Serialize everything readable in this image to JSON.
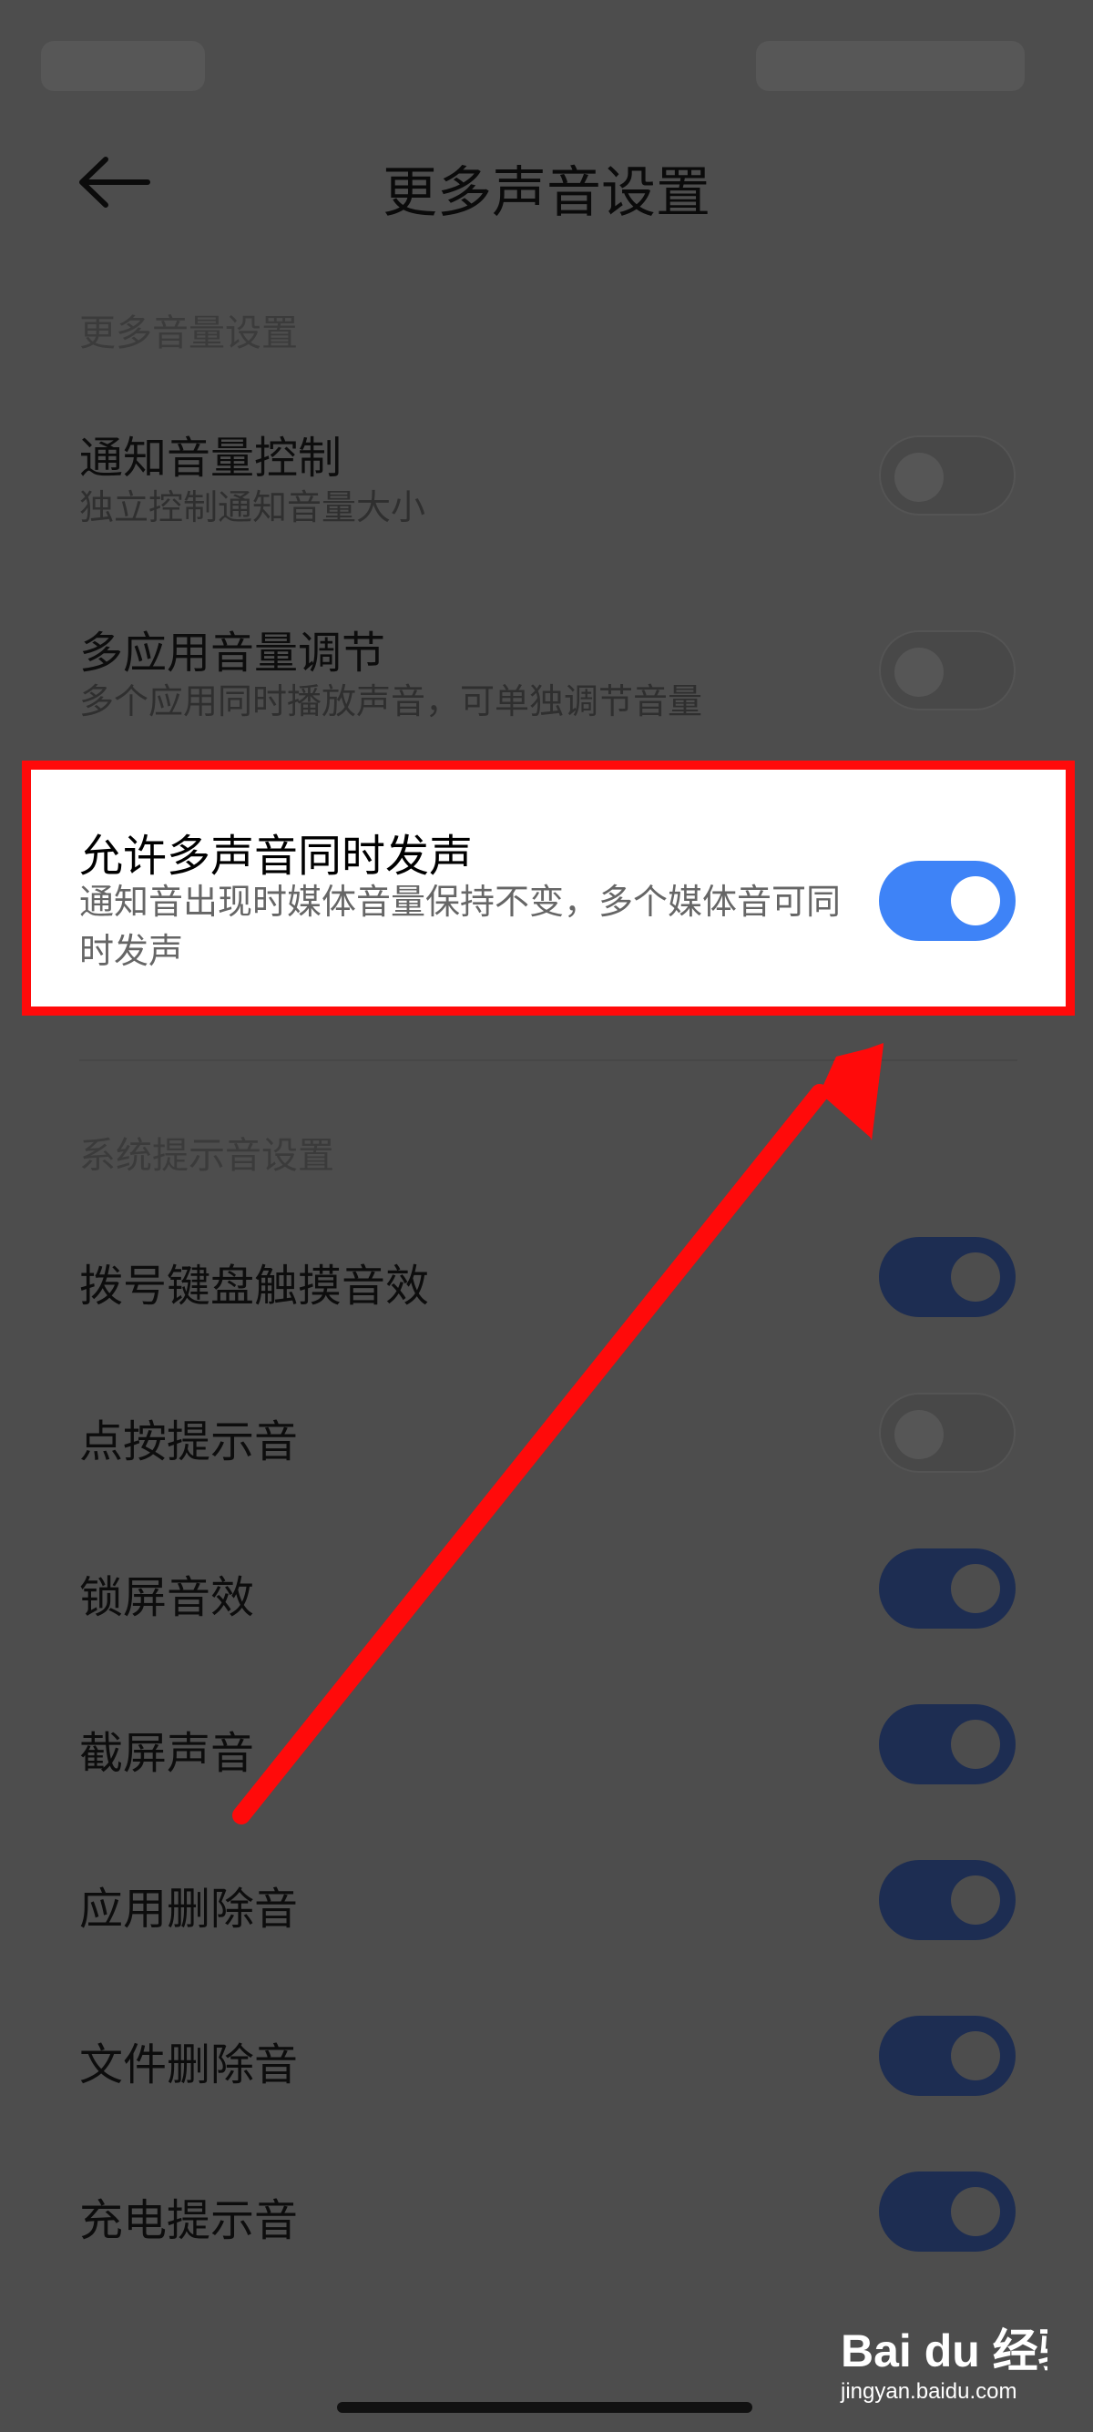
{
  "header": {
    "title": "更多声音设置"
  },
  "sections": [
    {
      "header": "更多音量设置",
      "items": [
        {
          "title": "通知音量控制",
          "subtitle": "独立控制通知音量大小",
          "enabled": false
        },
        {
          "title": "多应用音量调节",
          "subtitle": "多个应用同时播放声音，可单独调节音量",
          "enabled": false
        },
        {
          "title": "允许多声音同时发声",
          "subtitle": "通知音出现时媒体音量保持不变，多个媒体音可同时发声",
          "enabled": true
        }
      ]
    },
    {
      "header": "系统提示音设置",
      "items": [
        {
          "title": "拨号键盘触摸音效",
          "enabled": true
        },
        {
          "title": "点按提示音",
          "enabled": false
        },
        {
          "title": "锁屏音效",
          "enabled": true
        },
        {
          "title": "截屏声音",
          "enabled": true
        },
        {
          "title": "应用删除音",
          "enabled": true
        },
        {
          "title": "文件删除音",
          "enabled": true
        },
        {
          "title": "充电提示音",
          "enabled": true
        }
      ]
    }
  ],
  "watermark": {
    "brand": "Bai du 经验",
    "url": "jingyan.baidu.com"
  },
  "colors": {
    "toggle_on": "#3e83f7",
    "highlight_border": "#ff0a0a",
    "overlay_bg": "#4d4d4d"
  }
}
